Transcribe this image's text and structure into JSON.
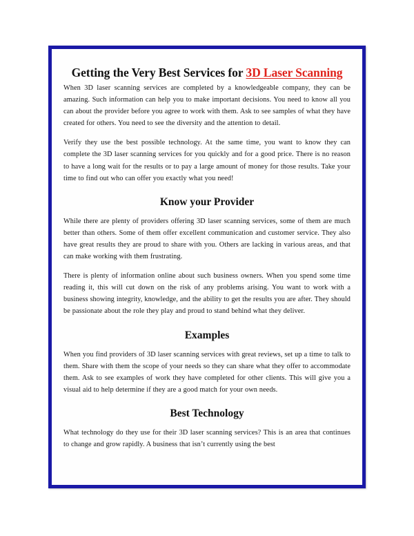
{
  "page": {
    "border_color": "#1a19a6",
    "background_color": "#ffffff",
    "link_color": "#e0231c",
    "text_color": "#141414"
  },
  "title": {
    "plain_part": "Getting the Very Best Services for ",
    "link_part": "3D Laser Scanning"
  },
  "sections": [
    {
      "heading": null,
      "paragraphs": [
        "When 3D laser scanning services are completed by a knowledgeable company, they can be amazing. Such information can help you to make important decisions. You need to know all you can about the provider before you agree to work with them. Ask to see samples of what they have created for others. You need to see the diversity and the attention to detail.",
        "Verify they use the best possible technology. At the same time, you want to know they can complete the 3D laser scanning services for you quickly and for a good price. There is no reason to have a long wait for the results or to pay a large amount of money for those results. Take your time to find out who can offer you exactly what you need!"
      ]
    },
    {
      "heading": "Know your Provider",
      "paragraphs": [
        "While there are plenty of providers offering 3D laser scanning services, some of them are much better than others. Some of them offer excellent communication and customer service. They also have great results they are proud to share with you. Others are lacking in various areas, and that can make working with them frustrating.",
        "There is plenty of information online about such business owners. When you spend some time reading it, this will cut down on the risk of any problems arising. You want to work with a business showing integrity, knowledge, and the ability to get the results you are after. They should be passionate about the role they play and proud to stand behind what they deliver."
      ]
    },
    {
      "heading": "Examples",
      "paragraphs": [
        "When you find providers of 3D laser scanning services with great reviews, set up a time to talk to them. Share with them the scope of your needs so they can share what they offer to accommodate them. Ask to see examples of work they have completed for other clients. This will give you a visual aid to help determine if they are a good match for your own needs."
      ]
    },
    {
      "heading": "Best Technology",
      "paragraphs": [
        "What technology do they use for their 3D laser scanning services? This is an area that continues to change and grow rapidly. A business that isn’t currently using the best"
      ]
    }
  ]
}
